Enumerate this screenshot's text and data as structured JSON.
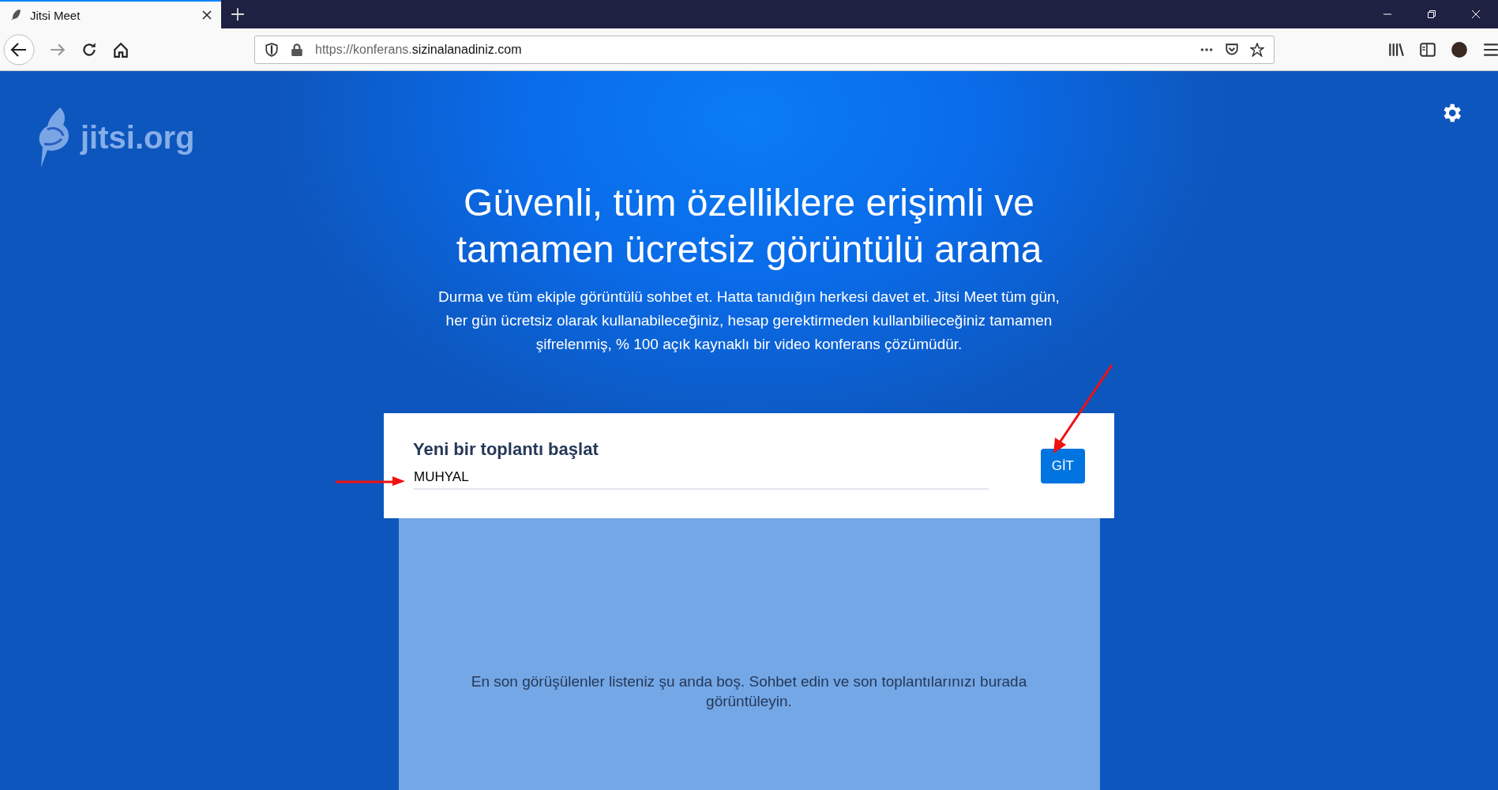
{
  "browser": {
    "tab": {
      "title": "Jitsi Meet",
      "selected": true
    },
    "address": {
      "faded": "https://konferans.",
      "main": "sizinalanadiniz.com"
    }
  },
  "page": {
    "logo": "jitsi.org",
    "heading": "Güvenli, tüm özelliklere erişimli ve tamamen ücretsiz görüntülü arama",
    "description": "Durma ve tüm ekiple görüntülü sohbet et. Hatta tanıdığın herkesi davet et. Jitsi Meet tüm gün, her gün ücretsiz olarak kullanabileceğiniz, hesap gerektirmeden kullanbilieceğiniz tamamen şifrelenmiş, % 100 açık kaynaklı bir video konferans çözümüdür.",
    "card": {
      "title": "Yeni bir toplantı başlat",
      "value": "MUHYAL",
      "button": "GİT"
    },
    "recent_empty": "En son görüşülenler listeniz şu anda boş. Sohbet edin ve son toplantılarınızı burada görüntüleyin."
  }
}
